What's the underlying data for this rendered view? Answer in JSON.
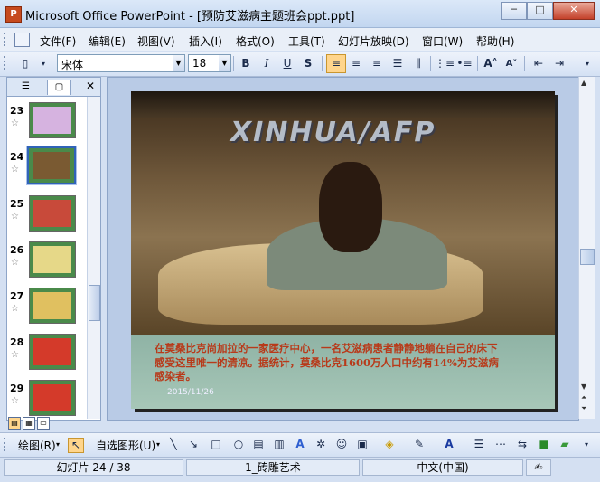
{
  "window": {
    "title": "Microsoft Office PowerPoint - [预防艾滋病主题班会ppt.ppt]",
    "app_icon": "P",
    "minimize": "─",
    "maximize": "□",
    "close": "✕"
  },
  "menu": {
    "items": [
      "文件(F)",
      "编辑(E)",
      "视图(V)",
      "插入(I)",
      "格式(O)",
      "工具(T)",
      "幻灯片放映(D)",
      "窗口(W)",
      "帮助(H)"
    ]
  },
  "formatting": {
    "font_name": "宋体",
    "font_size": "18",
    "bold": "B",
    "italic": "I",
    "underline": "U",
    "shadow": "S"
  },
  "slides_pane": {
    "thumbnails": [
      {
        "number": "23",
        "selected": false
      },
      {
        "number": "24",
        "selected": true
      },
      {
        "number": "25",
        "selected": false
      },
      {
        "number": "26",
        "selected": false
      },
      {
        "number": "27",
        "selected": false
      },
      {
        "number": "28",
        "selected": false
      },
      {
        "number": "29",
        "selected": false
      }
    ],
    "transition_icon": "☆"
  },
  "slide": {
    "watermark": "XINHUA/AFP",
    "caption": "在莫桑比克尚加拉的一家医疗中心，一名艾滋病患者静静地躺在自己的床下感受这里唯一的清凉。据统计，莫桑比克1600万人口中约有14%为艾滋病感染者。",
    "date": "2015/11/26"
  },
  "drawing_toolbar": {
    "draw_label": "绘图(R)",
    "autoshapes_label": "自选图形(U)"
  },
  "status": {
    "slide_pos": "幻灯片 24 / 38",
    "design": "1_砖雕艺术",
    "language": "中文(中国)"
  },
  "colors": {
    "accent": "#3063b8",
    "caption_text": "#b83a1a",
    "slide_panel": "#a7c7b8"
  }
}
